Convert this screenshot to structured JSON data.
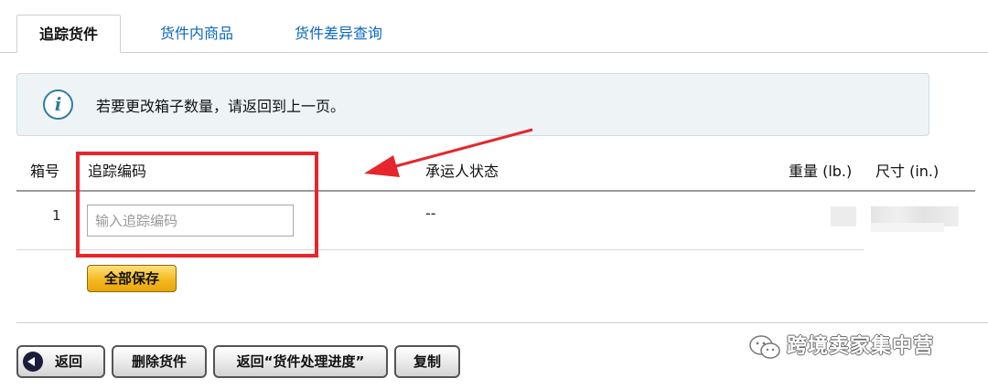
{
  "tabs": [
    {
      "label": "追踪货件",
      "active": true
    },
    {
      "label": "货件内商品",
      "active": false
    },
    {
      "label": "货件差异查询",
      "active": false
    }
  ],
  "info": {
    "icon": "info-icon",
    "glyph": "i",
    "message": "若要更改箱子数量，请返回到上一页。"
  },
  "table": {
    "headers": {
      "box_no": "箱号",
      "tracking": "追踪编码",
      "carrier_status": "承运人状态",
      "weight": "重量 (lb.)",
      "dimensions": "尺寸 (in.)"
    },
    "rows": [
      {
        "box_no": "1",
        "tracking_value": "",
        "tracking_placeholder": "输入追踪编码",
        "carrier_status": "--"
      }
    ]
  },
  "save_all_label": "全部保存",
  "bottom_buttons": {
    "back": "返回",
    "delete": "删除货件",
    "return_progress": "返回“货件处理进度”",
    "copy": "复制"
  },
  "watermark": "跨境卖家集中营",
  "colors": {
    "link": "#0a66c2",
    "highlight": "#e6262c",
    "info_bg": "#eef4f6",
    "save_button": "#f3b61b"
  }
}
